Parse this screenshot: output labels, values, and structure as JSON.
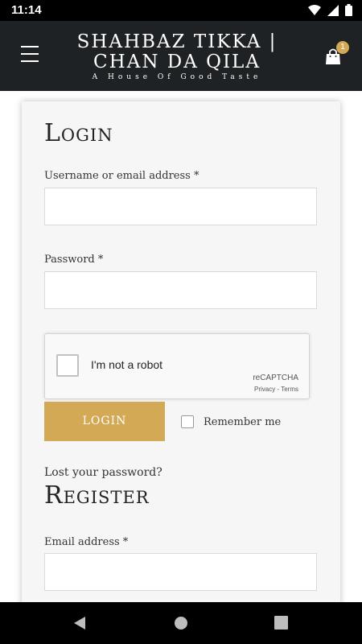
{
  "status_bar": {
    "time": "11:14"
  },
  "header": {
    "brand_line1": "SHAHBAZ TIKKA |",
    "brand_line2": "CHAN DA QILA",
    "tagline": "A House Of Good Taste",
    "cart_count": "1",
    "colors": {
      "background": "#1f2224",
      "accent": "#d4a955"
    }
  },
  "login": {
    "title": "Login",
    "username_label": "Username or email address *",
    "username_value": "",
    "password_label": "Password *",
    "password_value": "",
    "recaptcha": {
      "checkbox_label": "I'm not a robot",
      "brand": "reCAPTCHA",
      "links": "Privacy - Terms"
    },
    "submit_label": "LOGIN",
    "remember_label": "Remember me",
    "lost_password": "Lost your password?"
  },
  "register": {
    "title": "Register",
    "email_label": "Email address *",
    "email_value": ""
  },
  "icons": {
    "menu": "hamburger-icon",
    "cart": "shopping-bag-icon",
    "back": "back-triangle-icon",
    "home": "home-circle-icon",
    "recents": "recents-square-icon"
  }
}
